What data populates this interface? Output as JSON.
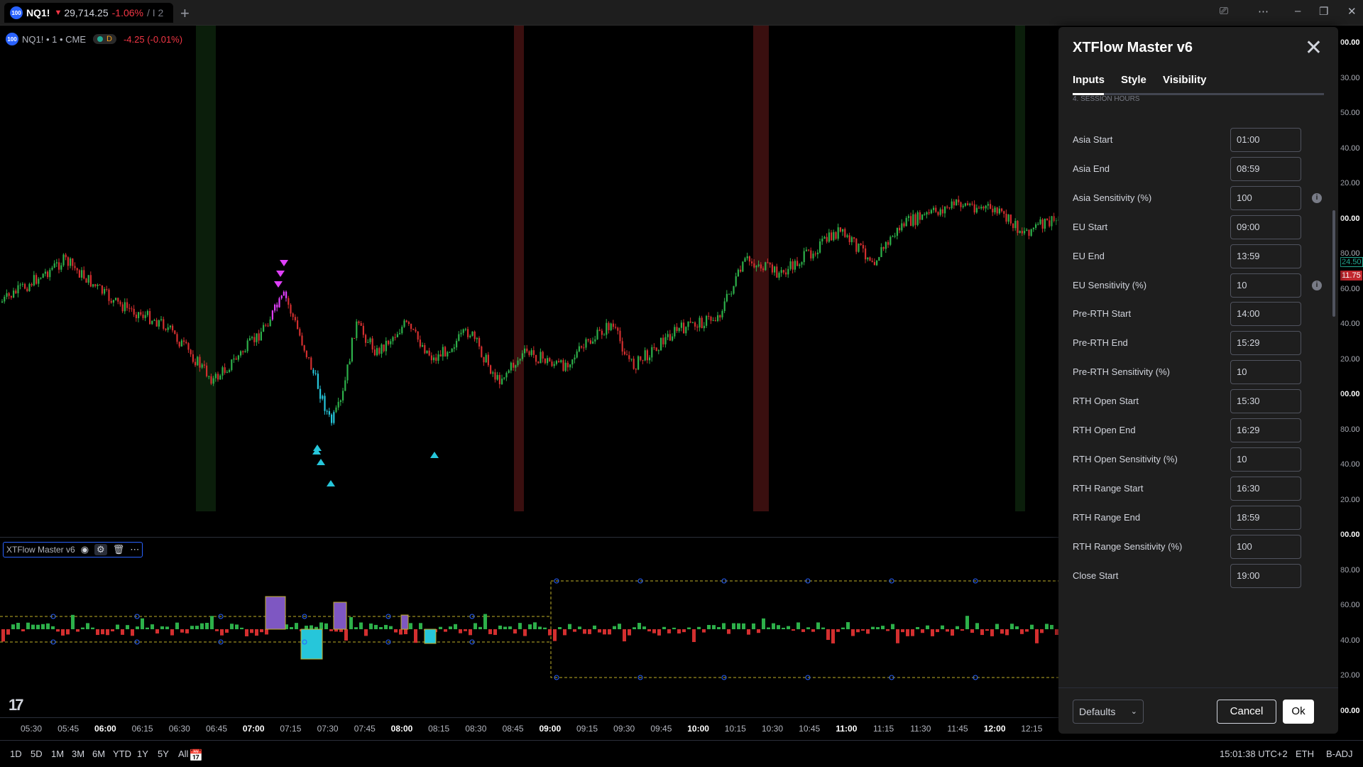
{
  "tab": {
    "symbol": "NQ1!",
    "arrow": "▼",
    "price": "29,714.25",
    "change": "-1.06%",
    "rest": "/ I 2",
    "logo": "100"
  },
  "legend": {
    "symbol_line": "NQ1! • 1 • CME",
    "badge": "D",
    "change": "-4.25 (-0.01%)"
  },
  "indicator_legend": {
    "name": "XTFlow Master v6"
  },
  "price_axis": [
    {
      "t": "00.00",
      "b": true
    },
    {
      "t": "30.00",
      "b": false
    },
    {
      "t": "50.00",
      "b": false
    },
    {
      "t": "40.00",
      "b": false
    },
    {
      "t": "20.00",
      "b": false
    },
    {
      "t": "00.00",
      "b": true
    },
    {
      "t": "80.00",
      "b": false
    },
    {
      "t": "60.00",
      "b": false
    },
    {
      "t": "40.00",
      "b": false
    },
    {
      "t": "20.00",
      "b": false
    },
    {
      "t": "00.00",
      "b": true
    },
    {
      "t": "80.00",
      "b": false
    },
    {
      "t": "40.00",
      "b": false
    },
    {
      "t": "20.00",
      "b": false
    },
    {
      "t": "00.00",
      "b": true
    },
    {
      "t": "80.00",
      "b": false
    },
    {
      "t": "60.00",
      "b": false
    },
    {
      "t": "40.00",
      "b": false
    },
    {
      "t": "20.00",
      "b": false
    },
    {
      "t": "00.00",
      "b": true
    }
  ],
  "price_tags": {
    "green": "24.50",
    "red": "11.75"
  },
  "time_axis": [
    {
      "t": "05:30",
      "m": false
    },
    {
      "t": "05:45",
      "m": false
    },
    {
      "t": "06:00",
      "m": true
    },
    {
      "t": "06:15",
      "m": false
    },
    {
      "t": "06:30",
      "m": false
    },
    {
      "t": "06:45",
      "m": false
    },
    {
      "t": "07:00",
      "m": true
    },
    {
      "t": "07:15",
      "m": false
    },
    {
      "t": "07:30",
      "m": false
    },
    {
      "t": "07:45",
      "m": false
    },
    {
      "t": "08:00",
      "m": true
    },
    {
      "t": "08:15",
      "m": false
    },
    {
      "t": "08:30",
      "m": false
    },
    {
      "t": "08:45",
      "m": false
    },
    {
      "t": "09:00",
      "m": true
    },
    {
      "t": "09:15",
      "m": false
    },
    {
      "t": "09:30",
      "m": false
    },
    {
      "t": "09:45",
      "m": false
    },
    {
      "t": "10:00",
      "m": true
    },
    {
      "t": "10:15",
      "m": false
    },
    {
      "t": "10:30",
      "m": false
    },
    {
      "t": "10:45",
      "m": false
    },
    {
      "t": "11:00",
      "m": true
    },
    {
      "t": "11:15",
      "m": false
    },
    {
      "t": "11:30",
      "m": false
    },
    {
      "t": "11:45",
      "m": false
    },
    {
      "t": "12:00",
      "m": true
    },
    {
      "t": "12:15",
      "m": false
    }
  ],
  "bottombar": {
    "ranges": [
      "1D",
      "5D",
      "1M",
      "3M",
      "6M",
      "YTD",
      "1Y",
      "5Y",
      "All"
    ],
    "time": "15:01:38 UTC+2",
    "session": "ETH",
    "adj": "B-ADJ"
  },
  "dialog": {
    "title": "XTFlow Master v6",
    "tabs": [
      "Inputs",
      "Style",
      "Visibility"
    ],
    "section": "4. SESSION HOURS",
    "rows": [
      {
        "label": "Asia Start",
        "value": "01:00",
        "info": false
      },
      {
        "label": "Asia End",
        "value": "08:59",
        "info": false
      },
      {
        "label": "Asia Sensitivity (%)",
        "value": "100",
        "info": true
      },
      {
        "label": "EU Start",
        "value": "09:00",
        "info": false
      },
      {
        "label": "EU End",
        "value": "13:59",
        "info": false
      },
      {
        "label": "EU Sensitivity (%)",
        "value": "10",
        "info": true
      },
      {
        "label": "Pre-RTH Start",
        "value": "14:00",
        "info": false
      },
      {
        "label": "Pre-RTH End",
        "value": "15:29",
        "info": false
      },
      {
        "label": "Pre-RTH Sensitivity (%)",
        "value": "10",
        "info": false
      },
      {
        "label": "RTH Open Start",
        "value": "15:30",
        "info": false
      },
      {
        "label": "RTH Open End",
        "value": "16:29",
        "info": false
      },
      {
        "label": "RTH Open Sensitivity (%)",
        "value": "10",
        "info": false
      },
      {
        "label": "RTH Range Start",
        "value": "16:30",
        "info": false
      },
      {
        "label": "RTH Range End",
        "value": "18:59",
        "info": false
      },
      {
        "label": "RTH Range Sensitivity (%)",
        "value": "100",
        "info": false
      },
      {
        "label": "Close Start",
        "value": "19:00",
        "info": false
      }
    ],
    "defaults_label": "Defaults",
    "cancel_label": "Cancel",
    "ok_label": "Ok"
  },
  "colors": {
    "up": "#22ab94",
    "down": "#c1272d",
    "green_candle": "#2db04a",
    "red_candle": "#d32f2f",
    "magenta": "#e040fb",
    "cyan": "#26c6da",
    "purple": "#7e57c2",
    "olive": "#c0b028"
  }
}
